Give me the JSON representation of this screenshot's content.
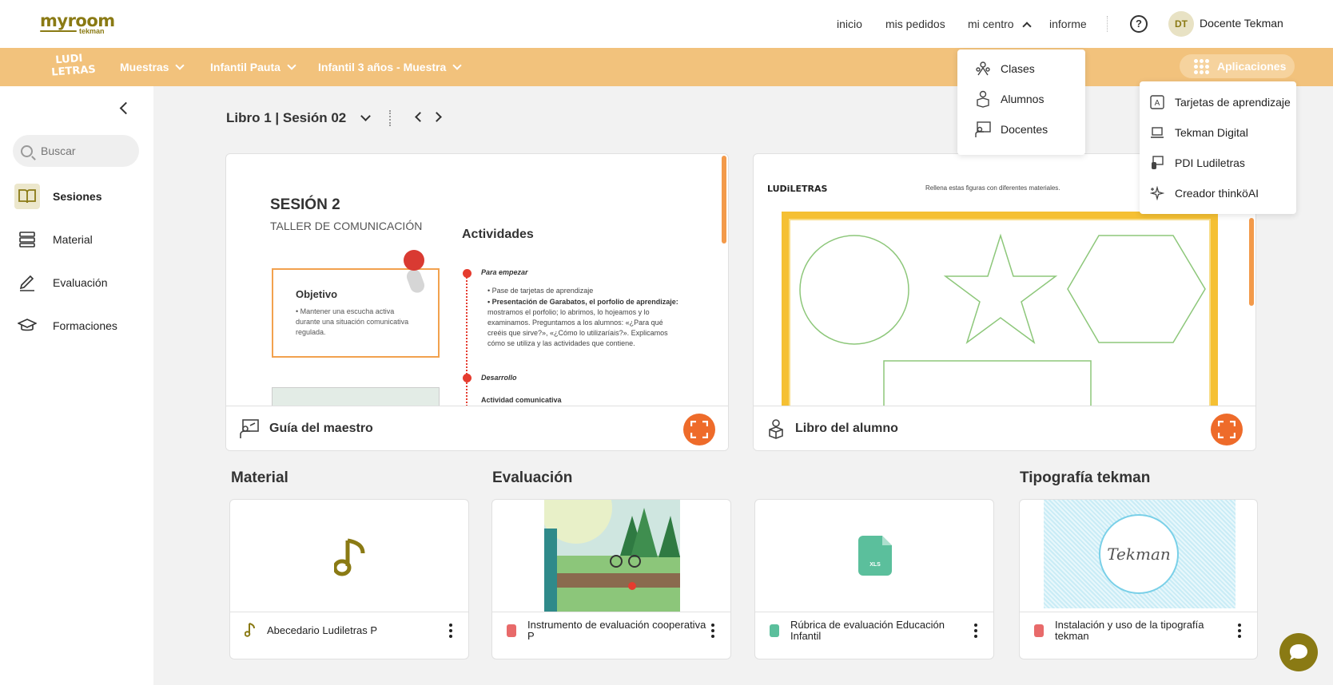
{
  "topbar": {
    "logo_main": "myroom",
    "logo_sub": "tekman",
    "nav": [
      "inicio",
      "mis pedidos",
      "mi centro",
      "informe"
    ],
    "avatar_initials": "DT",
    "user_name": "Docente Tekman",
    "help": "?"
  },
  "orangebar": {
    "logo_text": "LUDI LETRAS",
    "menus": [
      "Muestras",
      "Infantil Pauta",
      "Infantil 3 años - Muestra"
    ],
    "apps_label": "Aplicaciones"
  },
  "mi_centro_menu": [
    "Clases",
    "Alumnos",
    "Docentes"
  ],
  "apps_menu": [
    "Tarjetas de aprendizaje",
    "Tekman Digital",
    "PDI Ludiletras",
    "Creador thinköAI"
  ],
  "sidebar": {
    "search_placeholder": "Buscar",
    "items": [
      "Sesiones",
      "Material",
      "Evaluación",
      "Formaciones"
    ]
  },
  "main": {
    "book_title": "Libro 1 | Sesión 02",
    "cards": [
      {
        "label": "Guía del maestro",
        "page": {
          "title": "SESIÓN 2",
          "subtitle": "TALLER DE COMUNICACIÓN",
          "objective_title": "Objetivo",
          "objective_text": "• Mantener una escucha activa durante una situación comunicativa regulada.",
          "activities_title": "Actividades",
          "step1": "Para empezar",
          "bullet1": "• Pase de tarjetas de aprendizaje",
          "bullet2_bold": "• Presentación de Garabatos, el porfolio de aprendizaje:",
          "bullet2_rest": " mostramos el porfolio; lo abrimos, lo hojeamos y lo examinamos. Preguntamos a los alumnos: «¿Para qué creéis que sirve?», «¿Cómo lo utilizaríais?». Explicamos cómo se utiliza y las actividades que contiene.",
          "step2": "Desarrollo",
          "step2_sub": "Actividad comunicativa"
        }
      },
      {
        "label": "Libro del alumno",
        "page": {
          "logo": "LUDiLETRAS",
          "instruction": "Rellena estas figuras con diferentes materiales."
        }
      }
    ],
    "sections": [
      "Material",
      "Evaluación",
      "Tipografía tekman"
    ],
    "material_items": [
      {
        "title": "Abecedario Ludiletras P",
        "icon": "music-note-icon"
      },
      {
        "title": "Instrumento de evaluación cooperativa P",
        "icon": "file-icon"
      },
      {
        "title": "Rúbrica de evaluación Educación Infantil",
        "icon": "file-icon"
      },
      {
        "title": "Instalación y uso de la tipografía tekman",
        "icon": "file-icon"
      }
    ],
    "tekman_script": "Tekman",
    "xls_label": "XLS"
  },
  "colors": {
    "brand_olive": "#8a7a14",
    "orange_bar": "#f2c27c",
    "expand_orange": "#ee6b2a",
    "red_file": "#e86a6a",
    "green_file": "#5bbf9c"
  }
}
